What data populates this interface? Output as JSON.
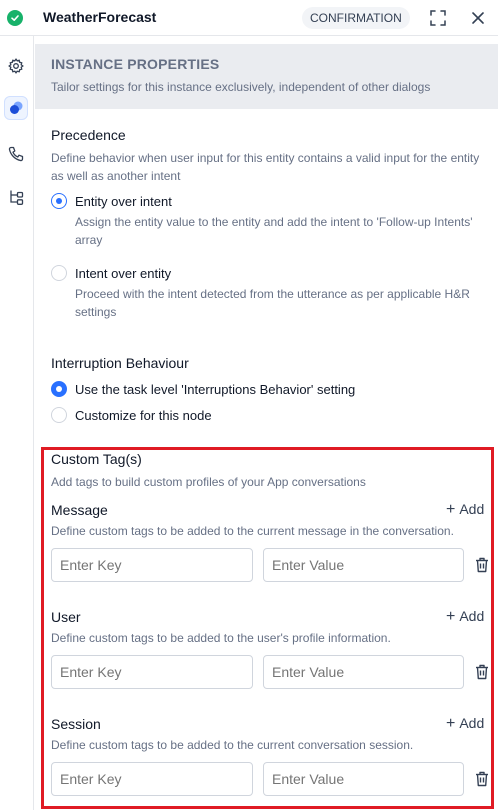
{
  "header": {
    "title": "WeatherForecast",
    "badge": "CONFIRMATION",
    "logo_icon": "check-circle-icon",
    "brand_color": "#17b26a"
  },
  "sidebar": {
    "items": [
      {
        "icon": "gear-icon"
      },
      {
        "icon": "instance-properties-icon",
        "active": true
      },
      {
        "icon": "phone-icon"
      },
      {
        "icon": "flow-icon"
      }
    ]
  },
  "banner": {
    "title": "INSTANCE PROPERTIES",
    "subtitle": "Tailor settings for this instance exclusively, independent of other dialogs"
  },
  "precedence": {
    "title": "Precedence",
    "description": "Define behavior when user input for this entity contains a valid input for the entity as well as another intent",
    "options": [
      {
        "label": "Entity over intent",
        "help": "Assign the entity value to the entity and add the intent to 'Follow-up Intents' array",
        "selected": true
      },
      {
        "label": "Intent over entity",
        "help": "Proceed with the intent detected from the utterance as per applicable H&R settings",
        "selected": false
      }
    ]
  },
  "interruption": {
    "title": "Interruption Behaviour",
    "options": [
      {
        "label": "Use the task level 'Interruptions Behavior' setting",
        "selected": true
      },
      {
        "label": "Customize for this node",
        "selected": false
      }
    ]
  },
  "custom_tags": {
    "title": "Custom Tag(s)",
    "description": "Add tags to build custom profiles of your App conversations",
    "add_label": "Add",
    "key_placeholder": "Enter Key",
    "value_placeholder": "Enter Value",
    "groups": [
      {
        "title": "Message",
        "description": "Define custom tags to be added to the current message in the conversation."
      },
      {
        "title": "User",
        "description": "Define custom tags to be added to the user's profile information."
      },
      {
        "title": "Session",
        "description": "Define custom tags to be added to the current conversation session."
      }
    ]
  },
  "colors": {
    "accent": "#2970ff",
    "highlight": "#e01b24"
  }
}
